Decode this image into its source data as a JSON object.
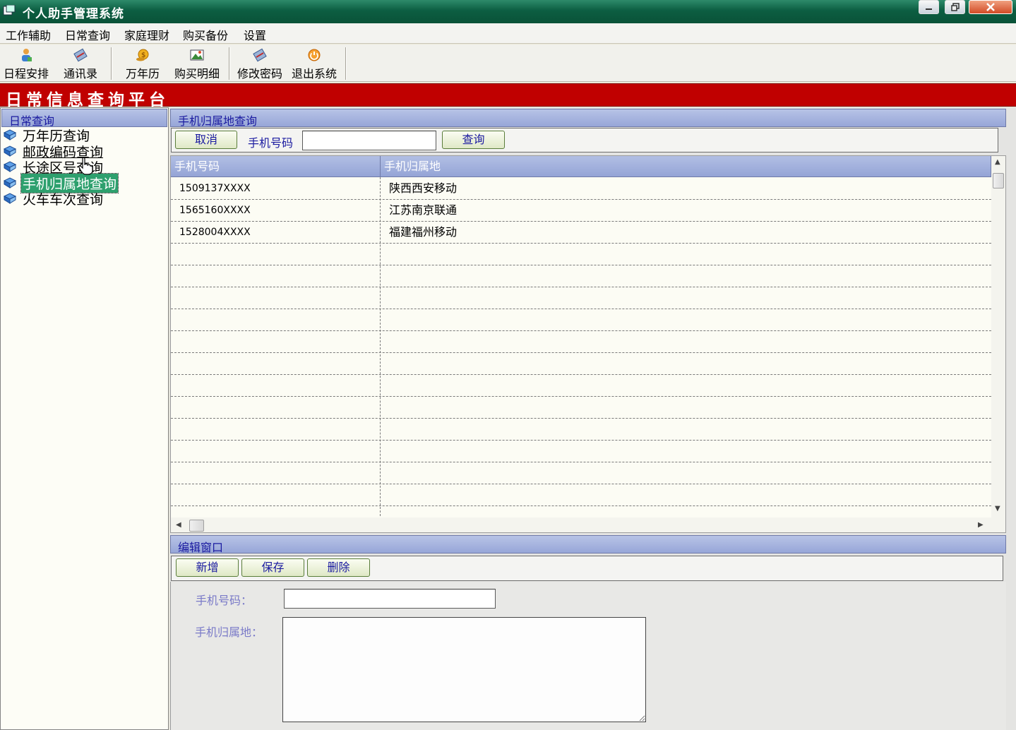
{
  "window": {
    "title": "个人助手管理系统"
  },
  "menu": [
    {
      "label": "工作辅助"
    },
    {
      "label": "日常查询"
    },
    {
      "label": "家庭理财"
    },
    {
      "label": "购买备份"
    },
    {
      "label": "设置"
    }
  ],
  "toolbar": [
    {
      "label": "日程安排",
      "icon": "person-icon"
    },
    {
      "label": "通讯录",
      "icon": "addressbook-icon"
    },
    {
      "label": "万年历",
      "icon": "coin-icon"
    },
    {
      "label": "购买明细",
      "icon": "picture-icon"
    },
    {
      "label": "修改密码",
      "icon": "key-icon"
    },
    {
      "label": "退出系统",
      "icon": "exit-icon"
    }
  ],
  "banner": {
    "title": "日常信息查询平台"
  },
  "sidebar": {
    "header": "日常查询",
    "items": [
      {
        "label": "万年历查询"
      },
      {
        "label": "邮政编码查询"
      },
      {
        "label": "长途区号查询"
      },
      {
        "label": "手机归属地查询"
      },
      {
        "label": "火车车次查询"
      }
    ]
  },
  "query": {
    "header": "手机归属地查询",
    "cancel_label": "取消",
    "phone_label": "手机号码",
    "phone_value": "",
    "search_label": "查询"
  },
  "grid": {
    "columns": [
      "手机号码",
      "手机归属地"
    ],
    "rows": [
      [
        "1509137XXXX",
        "陕西西安移动"
      ],
      [
        "1565160XXXX",
        "江苏南京联通"
      ],
      [
        "1528004XXXX",
        "福建福州移动"
      ]
    ]
  },
  "edit": {
    "header": "编辑窗口",
    "add_label": "新增",
    "save_label": "保存",
    "delete_label": "删除",
    "phone_label": "手机号码：",
    "location_label": "手机归属地：",
    "phone_value": "",
    "location_value": ""
  },
  "colors": {
    "banner": "#c00000",
    "titlebar": "#0c5e42",
    "header_blue": "#97a6d8",
    "selected": "#2ea06e"
  }
}
